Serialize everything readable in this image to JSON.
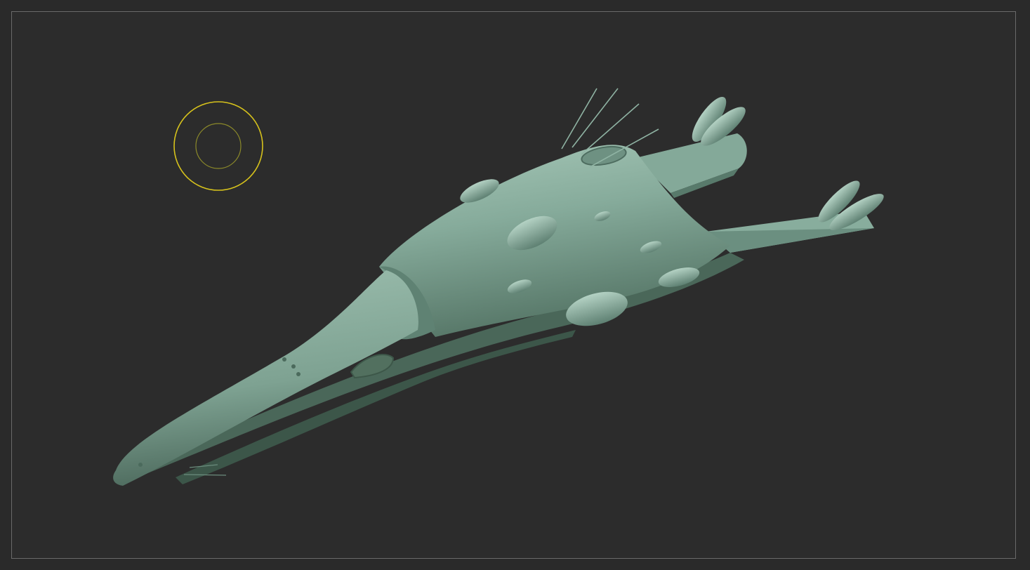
{
  "viewport": {
    "tool": "sculpt-viewport",
    "model": "spaceship-sculpt-mesh",
    "brush_cursor": "brush-draw-size-cursor"
  },
  "colors": {
    "background": "#2a2a2a",
    "frame_border": "#6a6a6a",
    "material": "#7fa595",
    "material_highlight": "#a9cbbb",
    "material_shadow": "#3f5a50",
    "brush_outer": "#d6c21c",
    "brush_inner": "#8c8a2a"
  }
}
